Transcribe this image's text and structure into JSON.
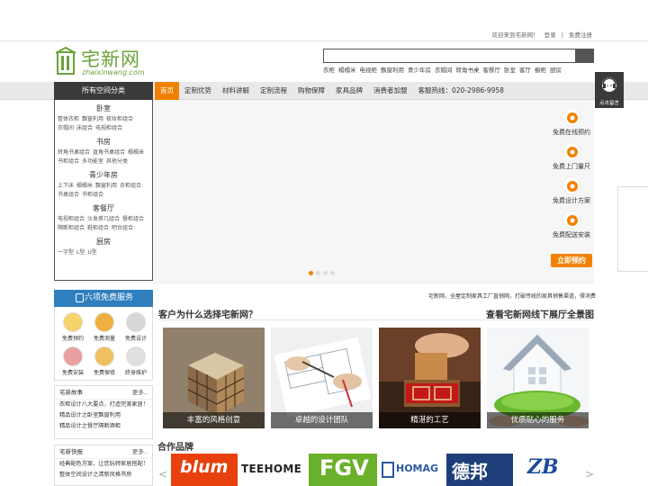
{
  "topbar": {
    "welcome": "欢迎来到宅新网！",
    "login": "登录",
    "sep": "|",
    "register": "免费注册"
  },
  "logo": {
    "cn": "宅新网",
    "en": "zhaixinwang.com"
  },
  "search": {
    "value": "",
    "placeholder": ""
  },
  "hotwords": [
    "衣柜",
    "榻榻米",
    "电视柜",
    "飘窗利用",
    "青少年房",
    "衣帽间",
    "转角书桌",
    "客餐厅",
    "卧室",
    "客厅",
    "橱柜",
    "厨房"
  ],
  "nav": {
    "category_head": "所有空间分类",
    "items": [
      "首页",
      "定制优势",
      "材料讲解",
      "定制流程",
      "购物保障",
      "家具品牌",
      "消费者加盟",
      "客服热线：020-2986-9958"
    ]
  },
  "categories": [
    {
      "title": "卧室",
      "subs": [
        "整体衣柜",
        "飘窗利用",
        "梳妆柜组合",
        "衣帽间",
        "床组合",
        "电视柜组合"
      ]
    },
    {
      "title": "书房",
      "subs": [
        "转角书桌组合",
        "直角书桌组合",
        "榻榻米",
        "书柜组合",
        "多功能室",
        "其他分类"
      ]
    },
    {
      "title": "青少年房",
      "subs": [
        "上下床",
        "榻榻米",
        "飘窗利用",
        "衣柜组合",
        "书桌组合",
        "书柜组合"
      ]
    },
    {
      "title": "客餐厅",
      "subs": [
        "电视柜组合",
        "沙发茶几组合",
        "餐柜组合",
        "隔断柜组合",
        "鞋柜组合",
        "吧台组合"
      ]
    },
    {
      "title": "厨房",
      "subs": [
        "一字型",
        "L型",
        "U型"
      ]
    }
  ],
  "services": [
    "免费在线预约",
    "免费上门量尺",
    "免费设计方案",
    "免费配送安装"
  ],
  "reserve_label": "立即预约",
  "float_msg": "点击留言",
  "six": {
    "title": "六项免费服务",
    "items": [
      "免费预约",
      "免费测量",
      "免费设计",
      "免费安装",
      "免费保修",
      "终身维护"
    ]
  },
  "news": {
    "title": "宅新故事",
    "more": "更多..",
    "items": [
      "衣柜设计八大要点，打造完美家居！",
      "精品设计之卧室飘窗利用",
      "精品设计之餐厅隔断酒柜"
    ]
  },
  "express": {
    "title": "宅新快报",
    "more": "更多..",
    "items": [
      "经典配色方案，让您玩转家居搭配！",
      "整体空间设计之清新风格书房"
    ]
  },
  "marquee": "宅新网，全屋定制家具工厂直销网，打破传统的家具销售渠道，得消费",
  "why": {
    "title": "客户为什么选择宅新网？",
    "show_title": "查看宅新网线下展厅全景图",
    "cards": [
      "丰富的风格创意",
      "卓越的设计团队",
      "精湛的工艺",
      "优质贴心的服务"
    ]
  },
  "brands": {
    "title": "合作品牌",
    "prev": "<",
    "next": ">",
    "items": [
      "blum",
      "TEEHOME",
      "FGV",
      "HOMAG",
      "德邦",
      "ZB"
    ]
  },
  "colors": {
    "accent": "#f08200",
    "logo_green": "#6aa33a",
    "six_blue": "#2f7fbf",
    "dark": "#3a3a3a"
  },
  "banner": {
    "slide_count": 4,
    "active_slide": 1
  }
}
